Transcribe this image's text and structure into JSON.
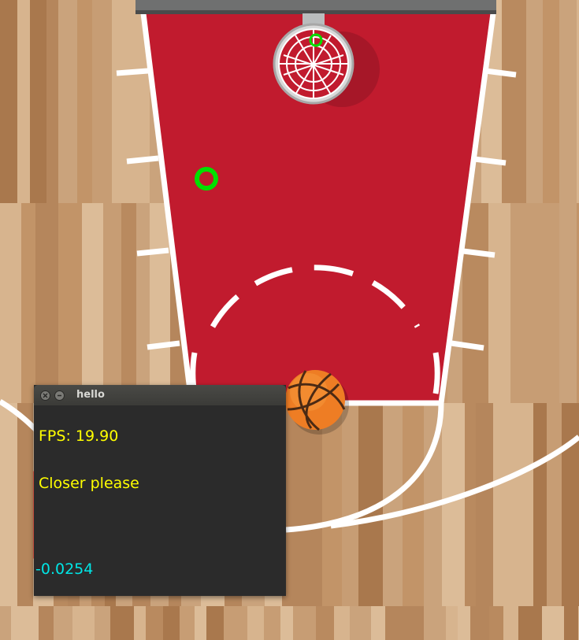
{
  "window": {
    "title": "hello"
  },
  "overlay": {
    "fps_text": "FPS: 19.90",
    "message": "Closer please",
    "value": "-0.0254"
  },
  "colors": {
    "court_red": "#c11b2e",
    "court_line": "#ffffff",
    "target_ring": "#00e000",
    "overlay_text": "#ffff00",
    "value_text": "#00e6e6",
    "face_box": "#ff0000"
  },
  "icons": [
    "close-icon",
    "minimize-icon",
    "hoop-icon",
    "basketball-icon",
    "target-ring-icon"
  ]
}
